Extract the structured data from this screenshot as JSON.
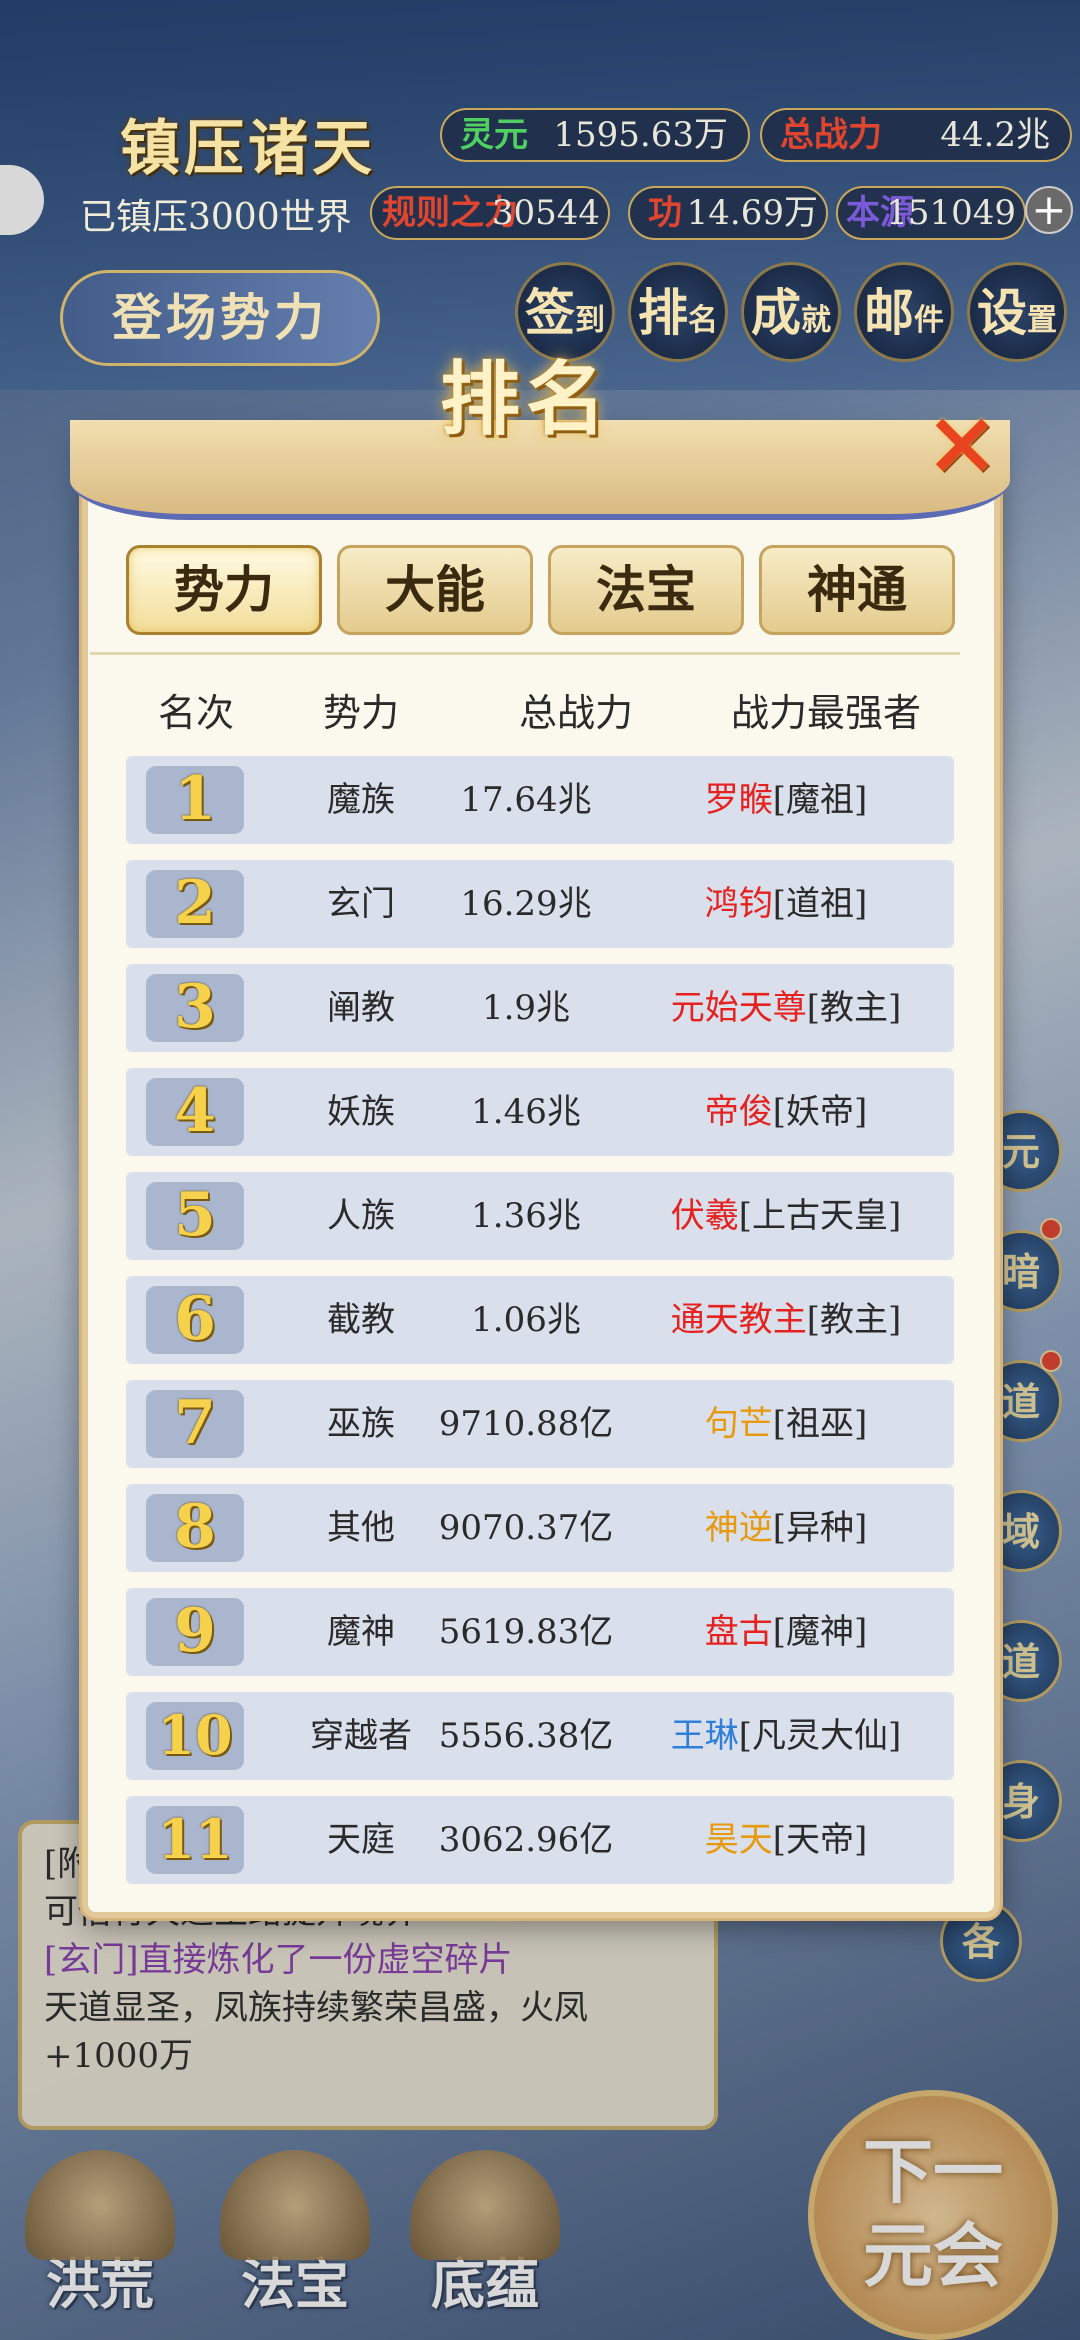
{
  "hud": {
    "title": "镇压诸天",
    "subtitle": "已镇压3000世界",
    "enter_label": "登场势力",
    "add_label": "+",
    "stats": [
      {
        "label": "灵元",
        "label_color": "#4fd060",
        "value": "1595.63万"
      },
      {
        "label": "总战力",
        "label_color": "#e0452f",
        "value": "44.2兆"
      },
      {
        "label": "规则之力",
        "label_color": "#e0452f",
        "value": "30544"
      },
      {
        "label": "功",
        "label_color": "#e0452f",
        "value": "14.69万"
      },
      {
        "label": "本源",
        "label_color": "#7a5ad8",
        "value": "151049"
      }
    ],
    "top_buttons": [
      {
        "main": "签",
        "small": "到"
      },
      {
        "main": "排",
        "small": "名"
      },
      {
        "main": "成",
        "small": "就"
      },
      {
        "main": "邮",
        "small": "件"
      },
      {
        "main": "设",
        "small": "置"
      }
    ]
  },
  "side_buttons": [
    "元",
    "暗",
    "道",
    "域",
    "道",
    "身",
    "各"
  ],
  "log": {
    "line1": "[附",
    "line2": "可借行天道圣路提升境界",
    "line3": "[玄门]直接炼化了一份虚空碎片",
    "line4": "天道显圣，凤族持续繁荣昌盛，火凤",
    "line5": "+1000万"
  },
  "bottom_nav": [
    "洪荒",
    "法宝",
    "底蕴"
  ],
  "next_button": {
    "line1": "下一",
    "line2": "元会"
  },
  "ranking": {
    "title": "排名",
    "close_icon": "×",
    "tabs": [
      "势力",
      "大能",
      "法宝",
      "神通"
    ],
    "active_tab": 0,
    "headers": [
      "名次",
      "势力",
      "总战力",
      "战力最强者"
    ],
    "rows": [
      {
        "rank": "1",
        "force": "魔族",
        "power": "17.64兆",
        "top_name": "罗睺",
        "top_color": "#e5221f",
        "top_title": "[魔祖]"
      },
      {
        "rank": "2",
        "force": "玄门",
        "power": "16.29兆",
        "top_name": "鸿钧",
        "top_color": "#e5221f",
        "top_title": "[道祖]"
      },
      {
        "rank": "3",
        "force": "阐教",
        "power": "1.9兆",
        "top_name": "元始天尊",
        "top_color": "#e5221f",
        "top_title": "[教主]"
      },
      {
        "rank": "4",
        "force": "妖族",
        "power": "1.46兆",
        "top_name": "帝俊",
        "top_color": "#e5221f",
        "top_title": "[妖帝]"
      },
      {
        "rank": "5",
        "force": "人族",
        "power": "1.36兆",
        "top_name": "伏羲",
        "top_color": "#e5221f",
        "top_title": "[上古天皇]"
      },
      {
        "rank": "6",
        "force": "截教",
        "power": "1.06兆",
        "top_name": "通天教主",
        "top_color": "#e5221f",
        "top_title": "[教主]"
      },
      {
        "rank": "7",
        "force": "巫族",
        "power": "9710.88亿",
        "top_name": "句芒",
        "top_color": "#e79a0e",
        "top_title": "[祖巫]"
      },
      {
        "rank": "8",
        "force": "其他",
        "power": "9070.37亿",
        "top_name": "神逆",
        "top_color": "#e79a0e",
        "top_title": "[异种]"
      },
      {
        "rank": "9",
        "force": "魔神",
        "power": "5619.83亿",
        "top_name": "盘古",
        "top_color": "#e5221f",
        "top_title": "[魔神]"
      },
      {
        "rank": "10",
        "force": "穿越者",
        "power": "5556.38亿",
        "top_name": "王琳",
        "top_color": "#2f7fd8",
        "top_title": "[凡灵大仙]"
      },
      {
        "rank": "11",
        "force": "天庭",
        "power": "3062.96亿",
        "top_name": "昊天",
        "top_color": "#e79a0e",
        "top_title": "[天帝]"
      }
    ]
  }
}
